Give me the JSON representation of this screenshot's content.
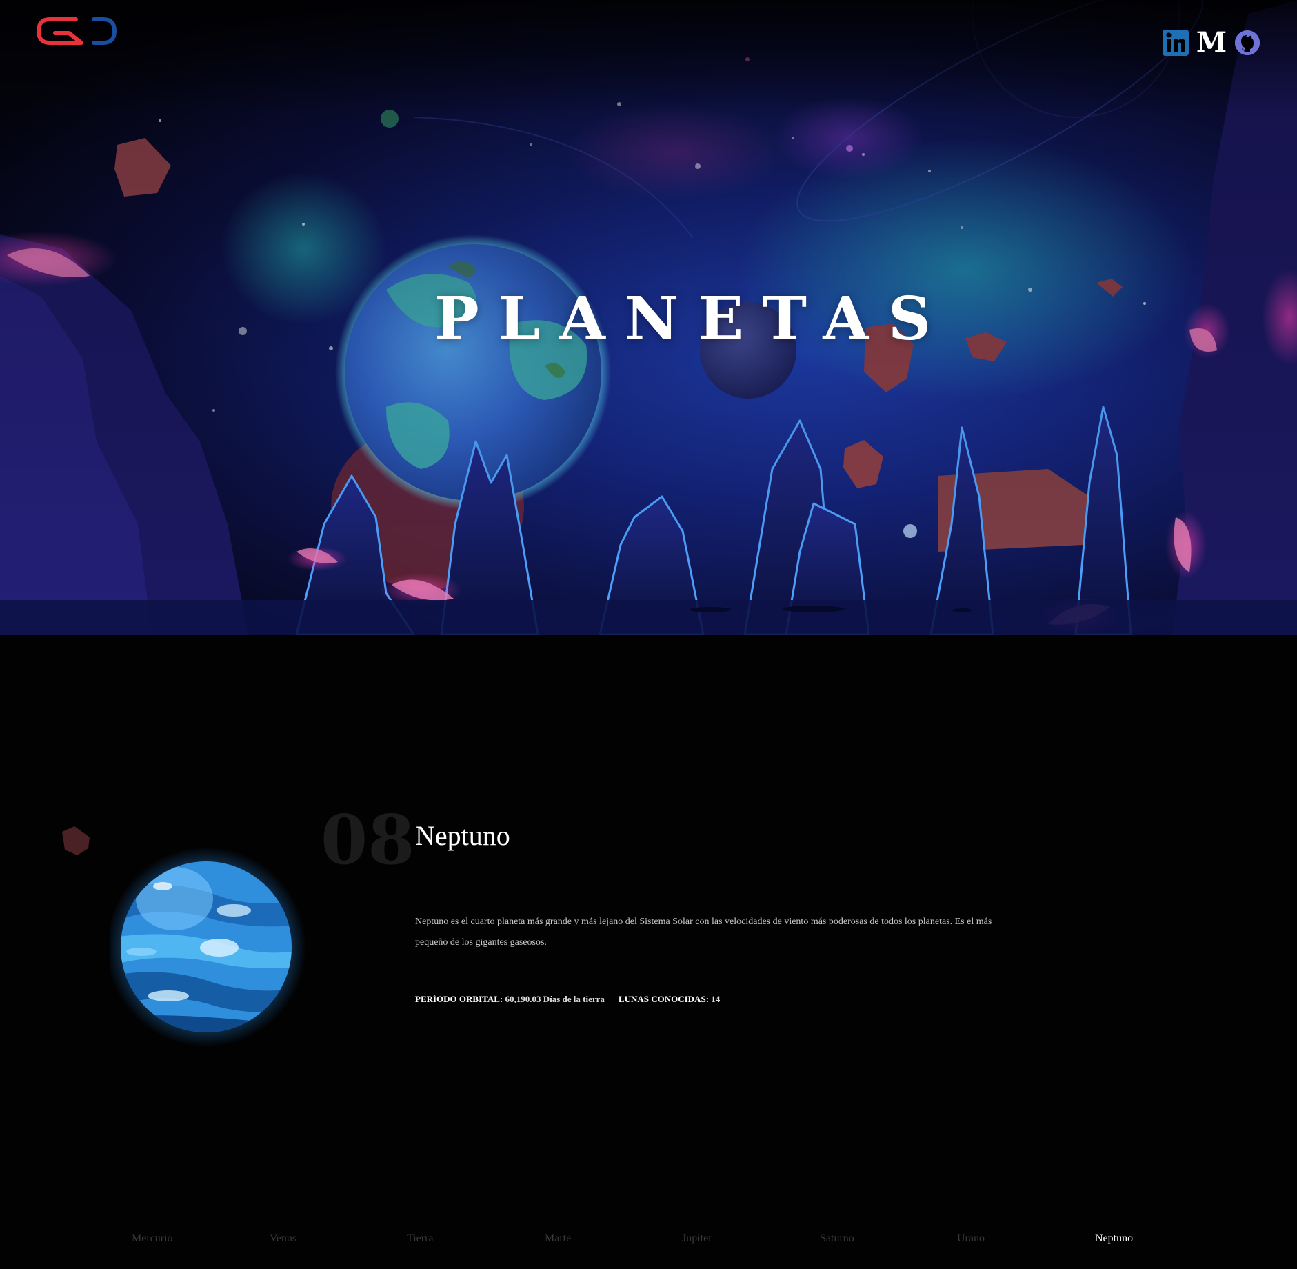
{
  "header": {
    "logo": "GD-logo",
    "social": [
      {
        "name": "linkedin",
        "icon": "linkedin-icon",
        "color": "#1e6fb4"
      },
      {
        "name": "medium",
        "icon": "medium-icon",
        "glyph": "M",
        "color": "#ffffff"
      },
      {
        "name": "github",
        "icon": "github-icon",
        "color": "#6f73d8"
      }
    ]
  },
  "hero": {
    "title": "PLANETAS"
  },
  "planet": {
    "number": "08",
    "name": "Neptuno",
    "description": "Neptuno es el cuarto planeta más grande y más lejano del Sistema Solar con las velocidades de viento más poderosas de todos los planetas. Es el más pequeño de los gigantes gaseosos.",
    "orbital_label": "PERÍODO ORBITAL:",
    "orbital_value": "60,190.03 Días de la tierra",
    "moons_label": "LUNAS CONOCIDAS:",
    "moons_value": "14"
  },
  "nav": {
    "items": [
      "Mercurio",
      "Venus",
      "Tierra",
      "Marte",
      "Jupiter",
      "Saturno",
      "Urano",
      "Neptuno"
    ],
    "active": "Neptuno"
  },
  "colors": {
    "background": "#020203",
    "logo_red": "#e8333b",
    "logo_blue": "#1a4ea0",
    "inactive_nav": "#3a3a3a",
    "active_nav": "#ffffff"
  }
}
